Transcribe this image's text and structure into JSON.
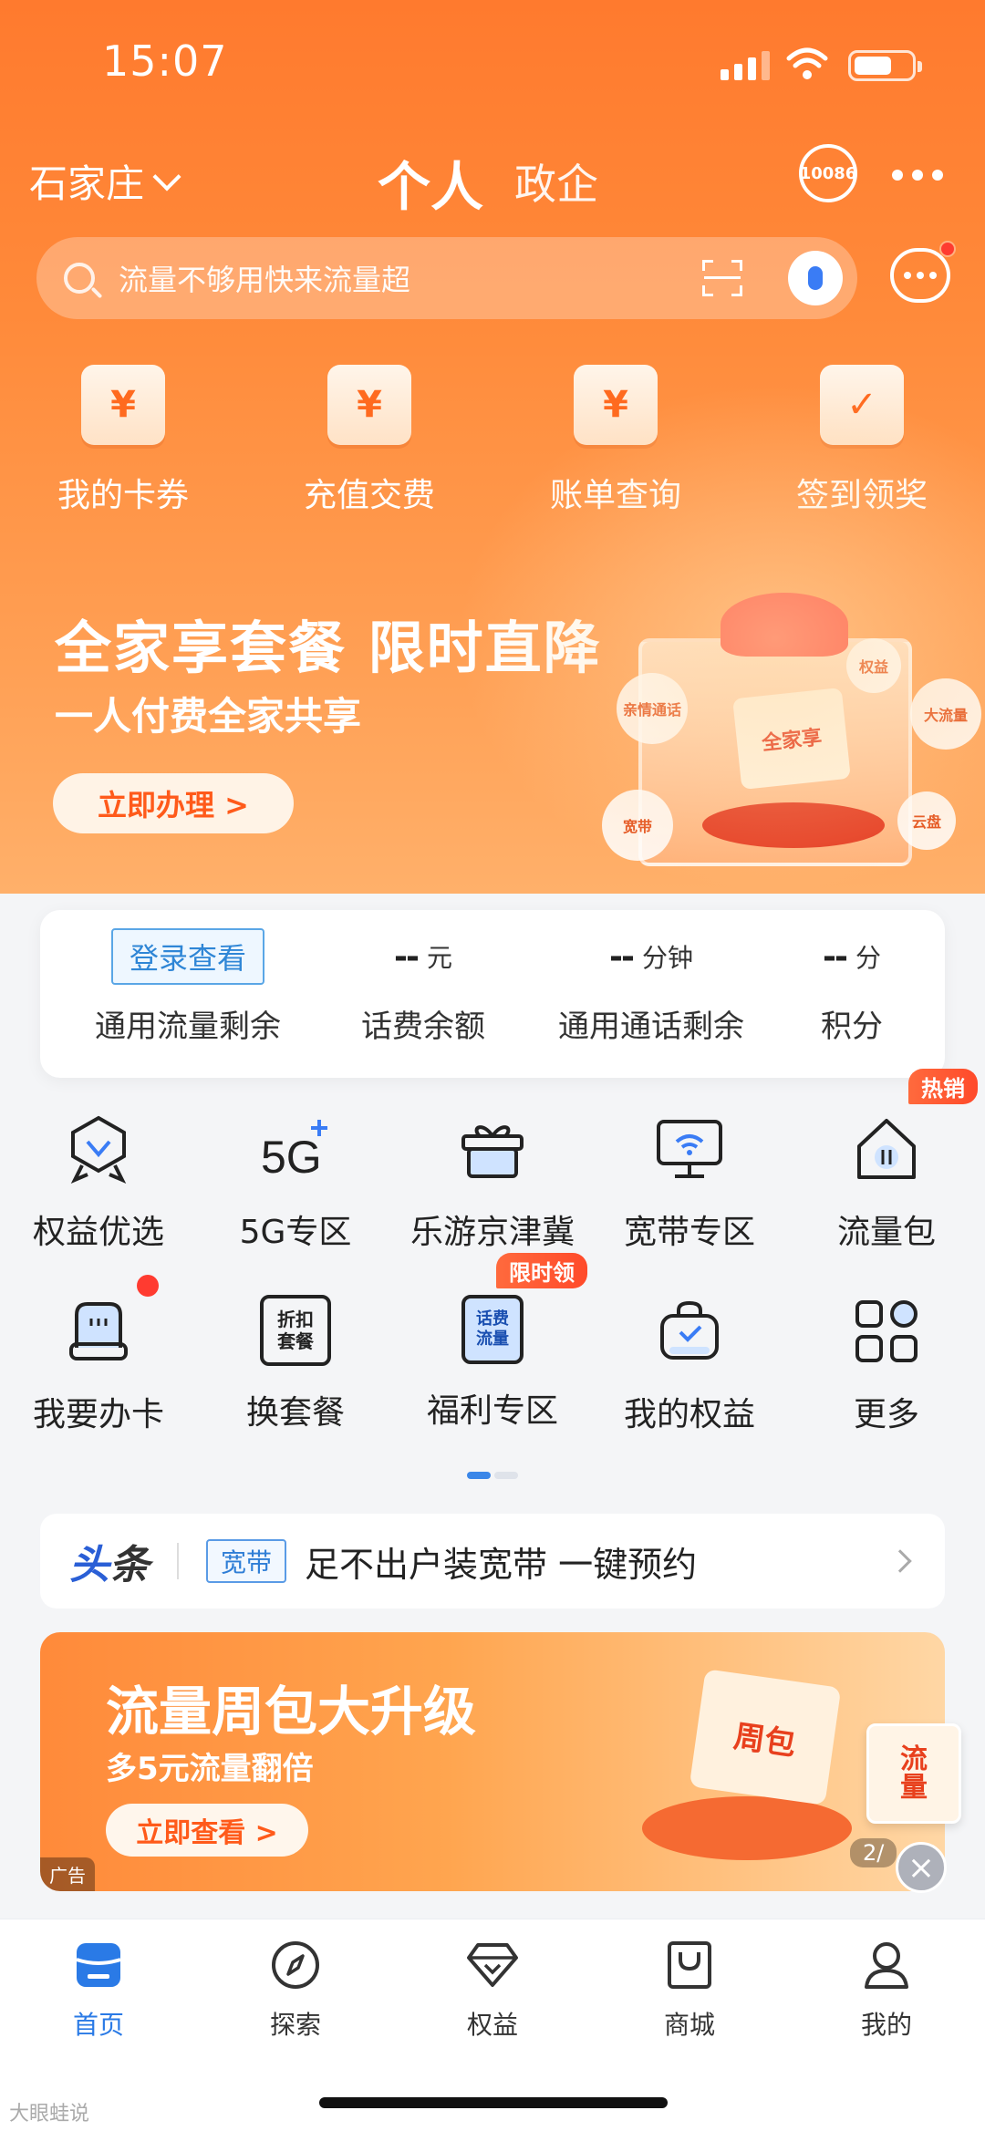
{
  "status_bar": {
    "time": "15:07"
  },
  "header": {
    "city": "石家庄",
    "tab_personal": "个人",
    "tab_gov": "政企",
    "hotline": "10086"
  },
  "search": {
    "placeholder": "流量不够用快来流量超"
  },
  "quick_actions": [
    {
      "label": "我的卡券",
      "icon": "coupon-icon"
    },
    {
      "label": "充值交费",
      "icon": "recharge-icon"
    },
    {
      "label": "账单查询",
      "icon": "bill-icon"
    },
    {
      "label": "签到领奖",
      "icon": "checkin-icon"
    }
  ],
  "hero_banner": {
    "title": "全家享套餐 限时直降",
    "subtitle": "一人付费全家共享",
    "button": "立即办理 >",
    "card_text": "全家享",
    "bubbles": [
      "亲情通话",
      "权益",
      "大流量",
      "宽带",
      "云盘"
    ]
  },
  "stats": {
    "login_button": "登录查看",
    "items": [
      {
        "label": "通用流量剩余"
      },
      {
        "value": "--",
        "unit": "元",
        "label": "话费余额"
      },
      {
        "value": "--",
        "unit": "分钟",
        "label": "通用通话剩余"
      },
      {
        "value": "--",
        "unit": "分",
        "label": "积分"
      }
    ]
  },
  "services": {
    "row1": [
      {
        "label": "权益优选",
        "icon": "badge-icon"
      },
      {
        "label": "5G专区",
        "icon": "5g-icon"
      },
      {
        "label": "乐游京津冀",
        "icon": "gift-icon"
      },
      {
        "label": "宽带专区",
        "icon": "broadband-icon"
      },
      {
        "label": "流量包",
        "icon": "data-pack-icon",
        "tag": "热销"
      }
    ],
    "row2": [
      {
        "label": "我要办卡",
        "icon": "sim-card-icon"
      },
      {
        "label": "换套餐",
        "icon": "discount-plan-icon",
        "icon_text": "折扣套餐"
      },
      {
        "label": "福利专区",
        "icon": "welfare-icon",
        "icon_text": "话费流量",
        "tag": "限时领"
      },
      {
        "label": "我的权益",
        "icon": "my-benefits-icon"
      },
      {
        "label": "更多",
        "icon": "more-grid-icon"
      }
    ]
  },
  "headline": {
    "logo_a": "头",
    "logo_b": "条",
    "tag": "宽带",
    "text": "足不出户装宽带 一键预约"
  },
  "ad_banner": {
    "title": "流量周包大升级",
    "subtitle": "多5元流量翻倍",
    "button": "立即查看 >",
    "ad_label": "广告",
    "package_text": "周包",
    "page": "2/"
  },
  "float_ad": {
    "text": "流量"
  },
  "bottom_nav": [
    {
      "label": "首页",
      "icon": "home-icon",
      "active": true
    },
    {
      "label": "探索",
      "icon": "compass-icon"
    },
    {
      "label": "权益",
      "icon": "diamond-icon"
    },
    {
      "label": "商城",
      "icon": "shop-bag-icon"
    },
    {
      "label": "我的",
      "icon": "user-icon"
    }
  ],
  "watermark": "大眼蛙说",
  "colors": {
    "primary": "#ff7a2e",
    "accent_blue": "#2a7ae6"
  }
}
